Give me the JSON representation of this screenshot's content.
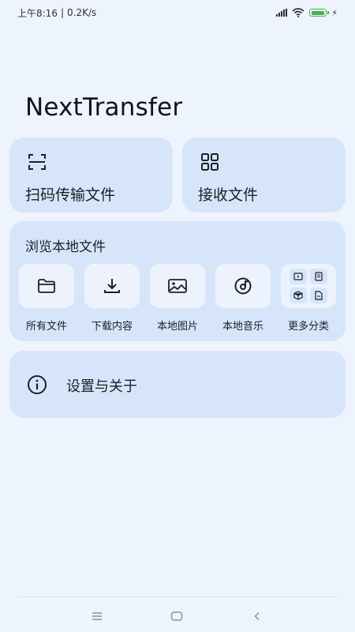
{
  "status_bar": {
    "time": "上午8:16",
    "separator": "|",
    "speed": "0.2K/s",
    "icons": [
      "signal-icon",
      "wifi-icon",
      "battery-icon",
      "charging-icon"
    ],
    "battery_color": "#4caf50"
  },
  "app": {
    "title": "NextTransfer"
  },
  "actions": {
    "scan": {
      "label": "扫码传输文件",
      "icon": "scan-icon"
    },
    "receive": {
      "label": "接收文件",
      "icon": "qr-code-icon"
    }
  },
  "browse": {
    "title": "浏览本地文件",
    "items": [
      {
        "label": "所有文件",
        "icon": "folder-icon"
      },
      {
        "label": "下载内容",
        "icon": "download-icon"
      },
      {
        "label": "本地图片",
        "icon": "image-icon"
      },
      {
        "label": "本地音乐",
        "icon": "music-disc-icon"
      },
      {
        "label": "更多分类",
        "icon": "more-categories-icon"
      }
    ]
  },
  "settings": {
    "label": "设置与关于",
    "icon": "info-icon"
  },
  "nav_bar": {
    "buttons": [
      "menu-icon",
      "home-icon",
      "back-icon"
    ]
  },
  "colors": {
    "background": "#eef4fd",
    "card": "#d7e5fb",
    "tile": "#edf3fd",
    "text": "#1b1f26"
  }
}
